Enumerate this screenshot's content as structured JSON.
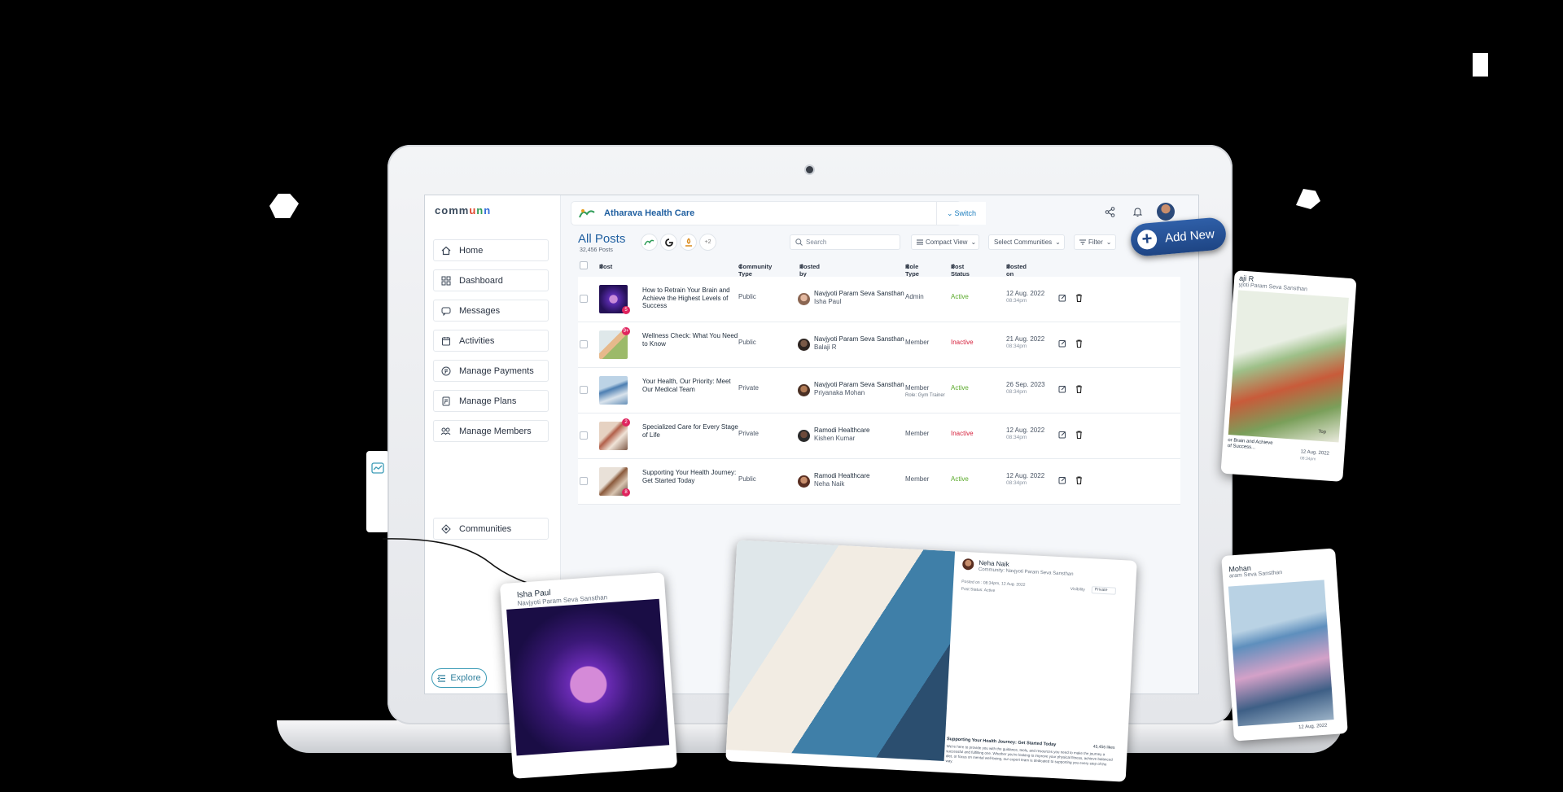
{
  "app": {
    "logo_text": "communn",
    "org_name": "Atharava Health Care",
    "switch_label": "Switch",
    "add_new_label": "Add New"
  },
  "sidebar": {
    "items": [
      {
        "label": "Home",
        "icon": "home-icon"
      },
      {
        "label": "Dashboard",
        "icon": "dashboard-icon"
      },
      {
        "label": "Messages",
        "icon": "messages-icon"
      },
      {
        "label": "Activities",
        "icon": "activities-icon"
      },
      {
        "label": "Manage Payments",
        "icon": "payments-icon"
      },
      {
        "label": "Manage Plans",
        "icon": "plans-icon"
      },
      {
        "label": "Manage Members",
        "icon": "members-icon"
      }
    ],
    "communities_label": "Communities",
    "explore_label": "Explore"
  },
  "posts": {
    "title": "All Posts",
    "count": "32,456 Posts",
    "more_chip": "+2",
    "search_placeholder": "Search",
    "view_label": "Compact View",
    "communities_select": "Select Communities",
    "filter_label": "Filter",
    "columns": [
      "Post",
      "Community Type",
      "Posted by",
      "Role Type",
      "Post Status",
      "Posted on"
    ],
    "rows": [
      {
        "title": "How to Retrain Your Brain and Achieve the Highest Levels of Success",
        "badge": "5",
        "community_type": "Public",
        "org": "Navjyoti Param Seva Sansthan",
        "author": "Isha Paul",
        "role": "Admin",
        "role_sub": "",
        "status": "Active",
        "date": "12 Aug. 2022",
        "time": "08:34pm"
      },
      {
        "title": "Wellness Check: What You Need to Know",
        "badge": "9+",
        "community_type": "Public",
        "org": "Navjyoti Param Seva Sansthan",
        "author": "Balaji R",
        "role": "Member",
        "role_sub": "",
        "status": "Inactive",
        "date": "21 Aug. 2022",
        "time": "08:34pm"
      },
      {
        "title": "Your Health, Our Priority: Meet Our Medical Team",
        "badge": "",
        "community_type": "Private",
        "org": "Navjyoti Param Seva Sansthan",
        "author": "Priyanaka Mohan",
        "role": "Member",
        "role_sub": "Role: Gym Trainer",
        "status": "Active",
        "date": "26 Sep. 2023",
        "time": "08:34pm"
      },
      {
        "title": "Specialized Care for Every Stage of Life",
        "badge": "2",
        "community_type": "Private",
        "org": "Ramodi Healthcare",
        "author": "Kishen Kumar",
        "role": "Member",
        "role_sub": "",
        "status": "Inactive",
        "date": "12 Aug. 2022",
        "time": "08:34pm"
      },
      {
        "title": "Supporting Your Health Journey: Get Started Today",
        "badge": "8",
        "community_type": "Public",
        "org": "Ramodi Healthcare",
        "author": "Neha Naik",
        "role": "Member",
        "role_sub": "",
        "status": "Active",
        "date": "12 Aug. 2022",
        "time": "08:34pm"
      }
    ]
  },
  "cards": {
    "isha": {
      "name": "Isha Paul",
      "org": "Navjyoti Param Seva Sansthan"
    },
    "neha": {
      "name": "Neha Naik",
      "org": "Community: Navjyoti Param Seva Sansthan",
      "posted": "Posted on : 08:34pm, 12 Aug. 2022",
      "status": "Post Status: Active",
      "visibility": "Visibility",
      "visibility_value": "Private",
      "footer_title": "Supporting Your Health Journey: Get Started Today",
      "footer_count": "45,456 likes",
      "footer_body": "We're here to provide you with the guidance, tools, and resources you need to make the journey a successful and fulfilling one. Whether you're looking to improve your physical fitness, achieve balanced diet, or focus on mental well-being, our expert team is dedicated to supporting you every step of the way."
    },
    "balaji": {
      "name": "aji R",
      "org": "yjoti Param Seva Sansthan",
      "caption": "or Brain and Achieve\nof Success...",
      "date": "12 Aug. 2022",
      "time": "08:34pm",
      "tag": "Top"
    },
    "mohan": {
      "name": "Mohan",
      "org": "aram Seva Sansthan",
      "date": "12 Aug. 2022"
    }
  },
  "colors": {
    "accent": "#1f5fa0",
    "active": "#5aaa2a",
    "inactive": "#d6243f",
    "button": "#1e4584"
  }
}
